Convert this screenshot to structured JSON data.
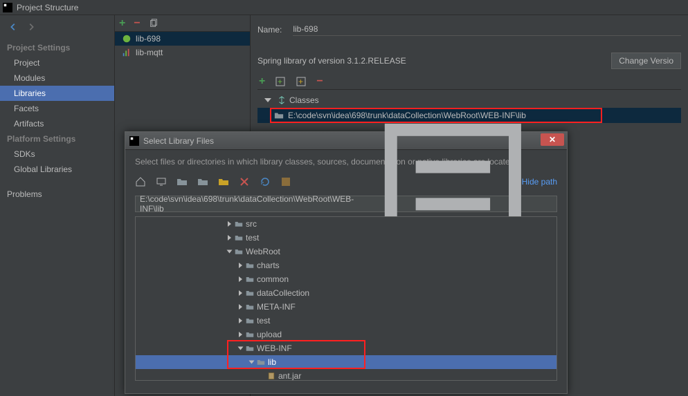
{
  "window": {
    "title": "Project Structure"
  },
  "sidebar": {
    "sections": [
      {
        "label": "Project Settings",
        "items": [
          {
            "label": "Project",
            "selected": false
          },
          {
            "label": "Modules",
            "selected": false
          },
          {
            "label": "Libraries",
            "selected": true
          },
          {
            "label": "Facets",
            "selected": false
          },
          {
            "label": "Artifacts",
            "selected": false
          }
        ]
      },
      {
        "label": "Platform Settings",
        "items": [
          {
            "label": "SDKs",
            "selected": false
          },
          {
            "label": "Global Libraries",
            "selected": false
          }
        ]
      }
    ],
    "extra": [
      {
        "label": "Problems"
      }
    ]
  },
  "libraries": {
    "items": [
      {
        "label": "lib-698",
        "selected": true,
        "icon": "spring"
      },
      {
        "label": "lib-mqtt",
        "selected": false,
        "icon": "bars"
      }
    ]
  },
  "detail": {
    "name_label": "Name:",
    "name_value": "lib-698",
    "version_text": "Spring library of version 3.1.2.RELEASE",
    "change_button": "Change Versio",
    "tree": {
      "classes_label": "Classes",
      "path": "E:\\code\\svn\\idea\\698\\trunk\\dataCollection\\WebRoot\\WEB-INF\\lib"
    }
  },
  "dialog": {
    "title": "Select Library Files",
    "hint": "Select files or directories in which library classes, sources, documentation or native libraries are located",
    "hide_path": "Hide path",
    "path_value": "E:\\code\\svn\\idea\\698\\trunk\\dataCollection\\WebRoot\\WEB-INF\\lib",
    "tree": [
      {
        "indent": 8,
        "arrow": "right",
        "label": "src"
      },
      {
        "indent": 8,
        "arrow": "right",
        "label": "test"
      },
      {
        "indent": 8,
        "arrow": "down",
        "label": "WebRoot"
      },
      {
        "indent": 9,
        "arrow": "right",
        "label": "charts"
      },
      {
        "indent": 9,
        "arrow": "right",
        "label": "common"
      },
      {
        "indent": 9,
        "arrow": "right",
        "label": "dataCollection"
      },
      {
        "indent": 9,
        "arrow": "right",
        "label": "META-INF"
      },
      {
        "indent": 9,
        "arrow": "right",
        "label": "test"
      },
      {
        "indent": 9,
        "arrow": "right",
        "label": "upload"
      },
      {
        "indent": 9,
        "arrow": "down",
        "label": "WEB-INF"
      },
      {
        "indent": 10,
        "arrow": "down",
        "label": "lib",
        "selected": true
      },
      {
        "indent": 11,
        "arrow": "none",
        "label": "ant.jar",
        "jar": true
      }
    ]
  }
}
